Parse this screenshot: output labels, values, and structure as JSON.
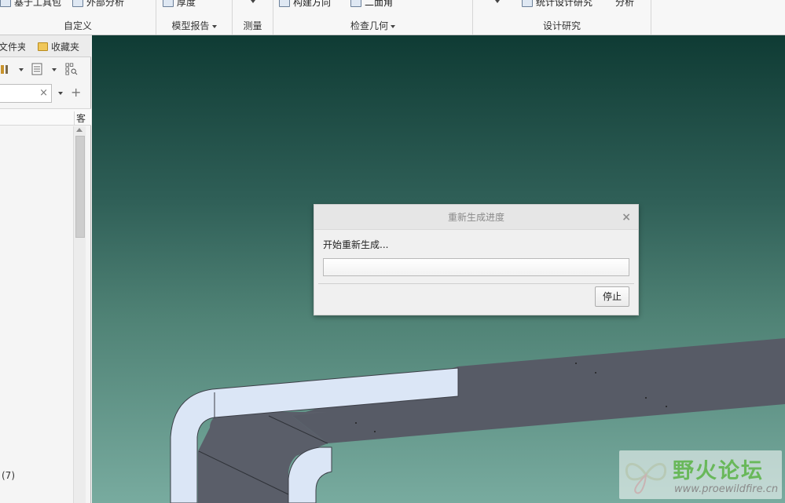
{
  "ribbon": {
    "groups": [
      {
        "title": "自定义",
        "buttons": [
          "基于工具包",
          "外部分析"
        ]
      },
      {
        "title": "模型报告",
        "buttons": [
          "厚度"
        ]
      },
      {
        "title": "测量",
        "buttons": [
          ""
        ]
      },
      {
        "title": "检查几何",
        "buttons": [
          "构建方向",
          "二面角"
        ]
      },
      {
        "title": "设计研究",
        "buttons": [
          "",
          "统计设计研究",
          "分析"
        ]
      }
    ]
  },
  "left_panel": {
    "tabs": [
      "文件夹",
      "收藏夹"
    ],
    "search_value": "",
    "column_header": "客",
    "tree_count": "(7)"
  },
  "dialog": {
    "title": "重新生成进度",
    "message": "开始重新生成...",
    "progress": 0,
    "stop_label": "停止",
    "close_glyph": "×"
  },
  "watermark": {
    "title": "野火论坛",
    "url": "www.proewildfire.cn"
  },
  "colors": {
    "viewport_top": "#0f3b34",
    "viewport_bottom": "#78ab9f",
    "part_dark": "#575b66",
    "part_light": "#dde8f7"
  }
}
